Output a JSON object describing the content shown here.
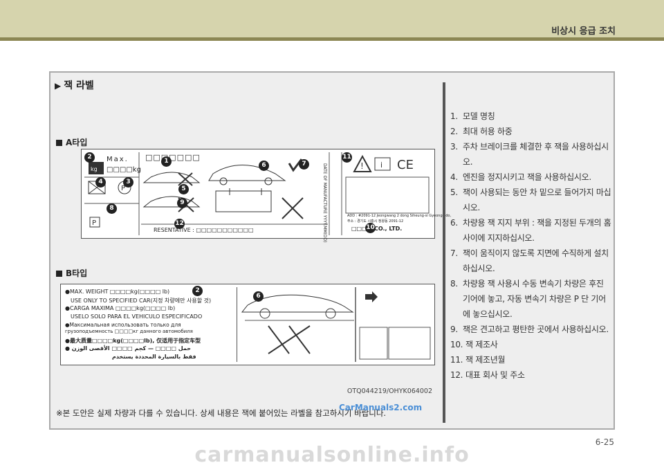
{
  "header": {
    "section_title": "비상시 응급 조치"
  },
  "panel": {
    "title": "잭 라벨",
    "type_a_label": "A타입",
    "type_b_label": "B타입",
    "image_code": "OTQ044219/OHYK064002",
    "footnote": "※본 도안은 실제 차량과 다를 수 있습니다. 상세 내용은 잭에 붙어있는 라벨을 참고하시기 바랍니다."
  },
  "label_a": {
    "max_text": "Max.",
    "kg_text": "□□□□kg",
    "squares_top": "□□□□□□□",
    "representative": "RESENTATIVE : □□□□□□□□□□□",
    "company": "□□□□  CO., LTD.",
    "date_vertical": "DATE OF MANUFACTURE YYYY.MM(DD)",
    "addr_line": "ADD : #2091-12 Jeongwang 2 dong Siheung-si Gyeonggido,",
    "addr_line2": "주소 : 경기도 시흥시 정왕동 2091-12",
    "markers": [
      "1",
      "2",
      "3",
      "4",
      "5",
      "6",
      "7",
      "8",
      "9",
      "10",
      "11",
      "12"
    ]
  },
  "label_b": {
    "lines": [
      "●MAX. WEIGHT □□□□kg(□□□□ lb)",
      "USE ONLY TO SPECIFIED CAR(지정 차량에만 사용할 것)",
      "●CARGA MAXIMA □□□□kg(□□□□ lb)",
      "USELO SOLO PARA EL VEHICULO ESPECIFICADO",
      "●Максимальная использовать только для",
      "грузоподъемность □□□□кг данного автомобиля",
      "●最大质量□□□□kg(□□□□lb), 仅适用于指定车型",
      "● حمل □□□□ — كجم □□□□ الأقصى الوزن",
      "فقط بالسيارة المحددة يستخدم"
    ],
    "markers": [
      "2",
      "6"
    ]
  },
  "list": [
    {
      "num": "1.",
      "text": "모델 명칭"
    },
    {
      "num": "2.",
      "text": "최대 허용 하중"
    },
    {
      "num": "3.",
      "text": "주차 브레이크를 체결한 후 잭을 사용하십시오."
    },
    {
      "num": "4.",
      "text": "엔진을 정지시키고 잭을 사용하십시오."
    },
    {
      "num": "5.",
      "text": "잭이 사용되는 동안 차 밑으로 들어가지 마십시오."
    },
    {
      "num": "6.",
      "text": "차량용 잭 지지 부위 : 잭을 지정된 두개의 홈 사이에 지지하십시오."
    },
    {
      "num": "7.",
      "text": "잭이 움직이지 않도록 지면에 수직하게 설치하십시오."
    },
    {
      "num": "8.",
      "text": "차량용 잭 사용시 수동 변속기 차량은 후진 기어에 놓고, 자동 변속기 차량은 P 단 기어에 놓으십시오."
    },
    {
      "num": "9.",
      "text": "잭은 견고하고 평탄한 곳에서 사용하십시오."
    },
    {
      "num": "10.",
      "text": "잭 제조사"
    },
    {
      "num": "11.",
      "text": "잭 제조년월"
    },
    {
      "num": "12.",
      "text": "대표 회사 및 주소"
    }
  ],
  "page_number": "6-25",
  "watermark_small": "CarManuals2.com",
  "watermark": "carmanualsonline.info"
}
